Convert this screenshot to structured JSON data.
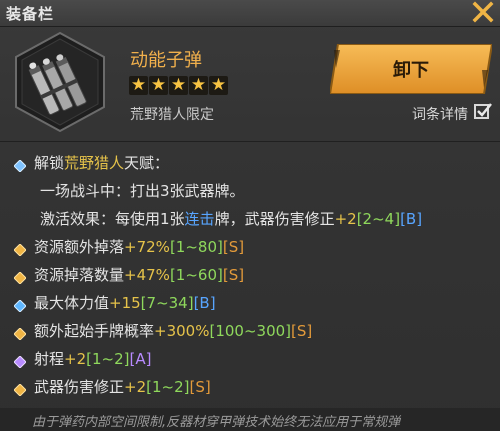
{
  "header": {
    "title": "装备栏"
  },
  "item": {
    "name": "动能子弹",
    "stars": 5,
    "limited": "荒野猎人限定"
  },
  "actions": {
    "unequip": "卸下",
    "detail": "词条详情",
    "detail_checked": true
  },
  "talent": {
    "prefix": "解锁",
    "name": "荒野猎人",
    "suffix": "天赋：",
    "line1": "一场战斗中：打出3张武器牌。",
    "line2_a": "激活效果：每使用1张",
    "line2_keyword": "连击",
    "line2_b": "牌，武器伤害修正",
    "line2_val": "+2",
    "line2_range": "[2~4]",
    "line2_grade": "[B]"
  },
  "stats": [
    {
      "label": "资源额外掉落",
      "value": "+72%",
      "range": "[1~80]",
      "grade": "[S]",
      "bullet": "orange"
    },
    {
      "label": "资源掉落数量",
      "value": "+47%",
      "range": "[1~60]",
      "grade": "[S]",
      "bullet": "orange"
    },
    {
      "label": "最大体力值",
      "value": "+15",
      "range": "[7~34]",
      "grade": "[B]",
      "bullet": "blue"
    },
    {
      "label": "额外起始手牌概率",
      "value": "+300%",
      "range": "[100~300]",
      "grade": "[S]",
      "bullet": "orange"
    },
    {
      "label": "射程",
      "value": "+2",
      "range": "[1~2]",
      "grade": "[A]",
      "bullet": "purple"
    },
    {
      "label": "武器伤害修正",
      "value": "+2",
      "range": "[1~2]",
      "grade": "[S]",
      "bullet": "orange"
    }
  ],
  "footer": "由于弹药内部空间限制,反器材穿甲弹技术始终无法应用于常规弹",
  "colors": {
    "accent": "#f1b04c",
    "grade_s": "#e39a3a",
    "grade_b": "#58a5ff",
    "grade_a": "#b88bff",
    "range": "#8fd85c"
  }
}
